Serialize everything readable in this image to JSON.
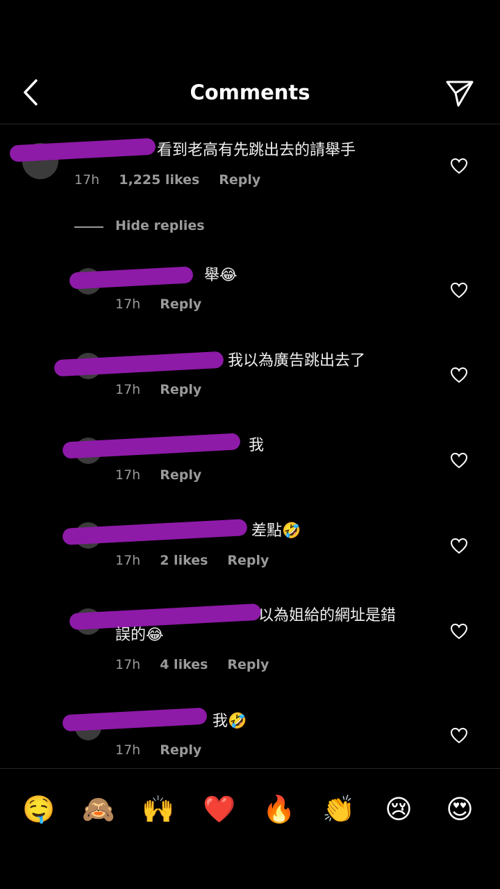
{
  "header": {
    "title": "Comments"
  },
  "main_comment": {
    "text": "看到老高有先跳出去的請舉手",
    "time": "17h",
    "likes": "1,225 likes",
    "reply": "Reply"
  },
  "hide_replies": "Hide replies",
  "replies": [
    {
      "text": "舉😂",
      "time": "17h",
      "likes": "",
      "reply": "Reply"
    },
    {
      "text": "我以為廣告跳出去了",
      "time": "17h",
      "likes": "",
      "reply": "Reply"
    },
    {
      "text": "我",
      "time": "17h",
      "likes": "",
      "reply": "Reply"
    },
    {
      "text": "差點🤣",
      "time": "17h",
      "likes": "2 likes",
      "reply": "Reply"
    },
    {
      "text": "以為姐給的網址是錯",
      "text2": "誤的😂",
      "time": "17h",
      "likes": "4 likes",
      "reply": "Reply"
    },
    {
      "text": "我🤣",
      "time": "17h",
      "likes": "",
      "reply": "Reply"
    }
  ],
  "reactions": [
    "🤤",
    "🙈",
    "🙌",
    "❤️",
    "🔥",
    "👏",
    "😢",
    "😍"
  ],
  "colors": {
    "background": "#000000",
    "redaction": "#8e1aa8",
    "meta": "#9a9a9a"
  }
}
